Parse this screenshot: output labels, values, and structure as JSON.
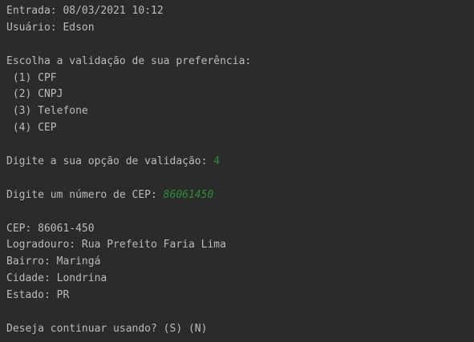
{
  "console": {
    "lines": [
      {
        "text": "Entrada: 08/03/2021 10:12"
      },
      {
        "text": "Usuário: Edson"
      },
      {
        "text": ""
      },
      {
        "text": "Escolha a validação de sua preferência:"
      },
      {
        "text": " (1) CPF"
      },
      {
        "text": " (2) CNPJ"
      },
      {
        "text": " (3) Telefone"
      },
      {
        "text": " (4) CEP"
      },
      {
        "text": ""
      },
      {
        "text": "Digite a sua opção de validação: ",
        "input": "4"
      },
      {
        "text": ""
      },
      {
        "text": "Digite um número de CEP: ",
        "input": "86061450"
      },
      {
        "text": ""
      },
      {
        "text": "CEP: 86061-450"
      },
      {
        "text": "Logradouro: Rua Prefeito Faria Lima"
      },
      {
        "text": "Bairro: Maringá"
      },
      {
        "text": "Cidade: Londrina"
      },
      {
        "text": "Estado: PR"
      },
      {
        "text": ""
      },
      {
        "text": "Deseja continuar usando? (S) (N)"
      }
    ]
  },
  "colors": {
    "background": "#2b2b2b",
    "text": "#bbbbbb",
    "user_input": "#2c8c36"
  }
}
